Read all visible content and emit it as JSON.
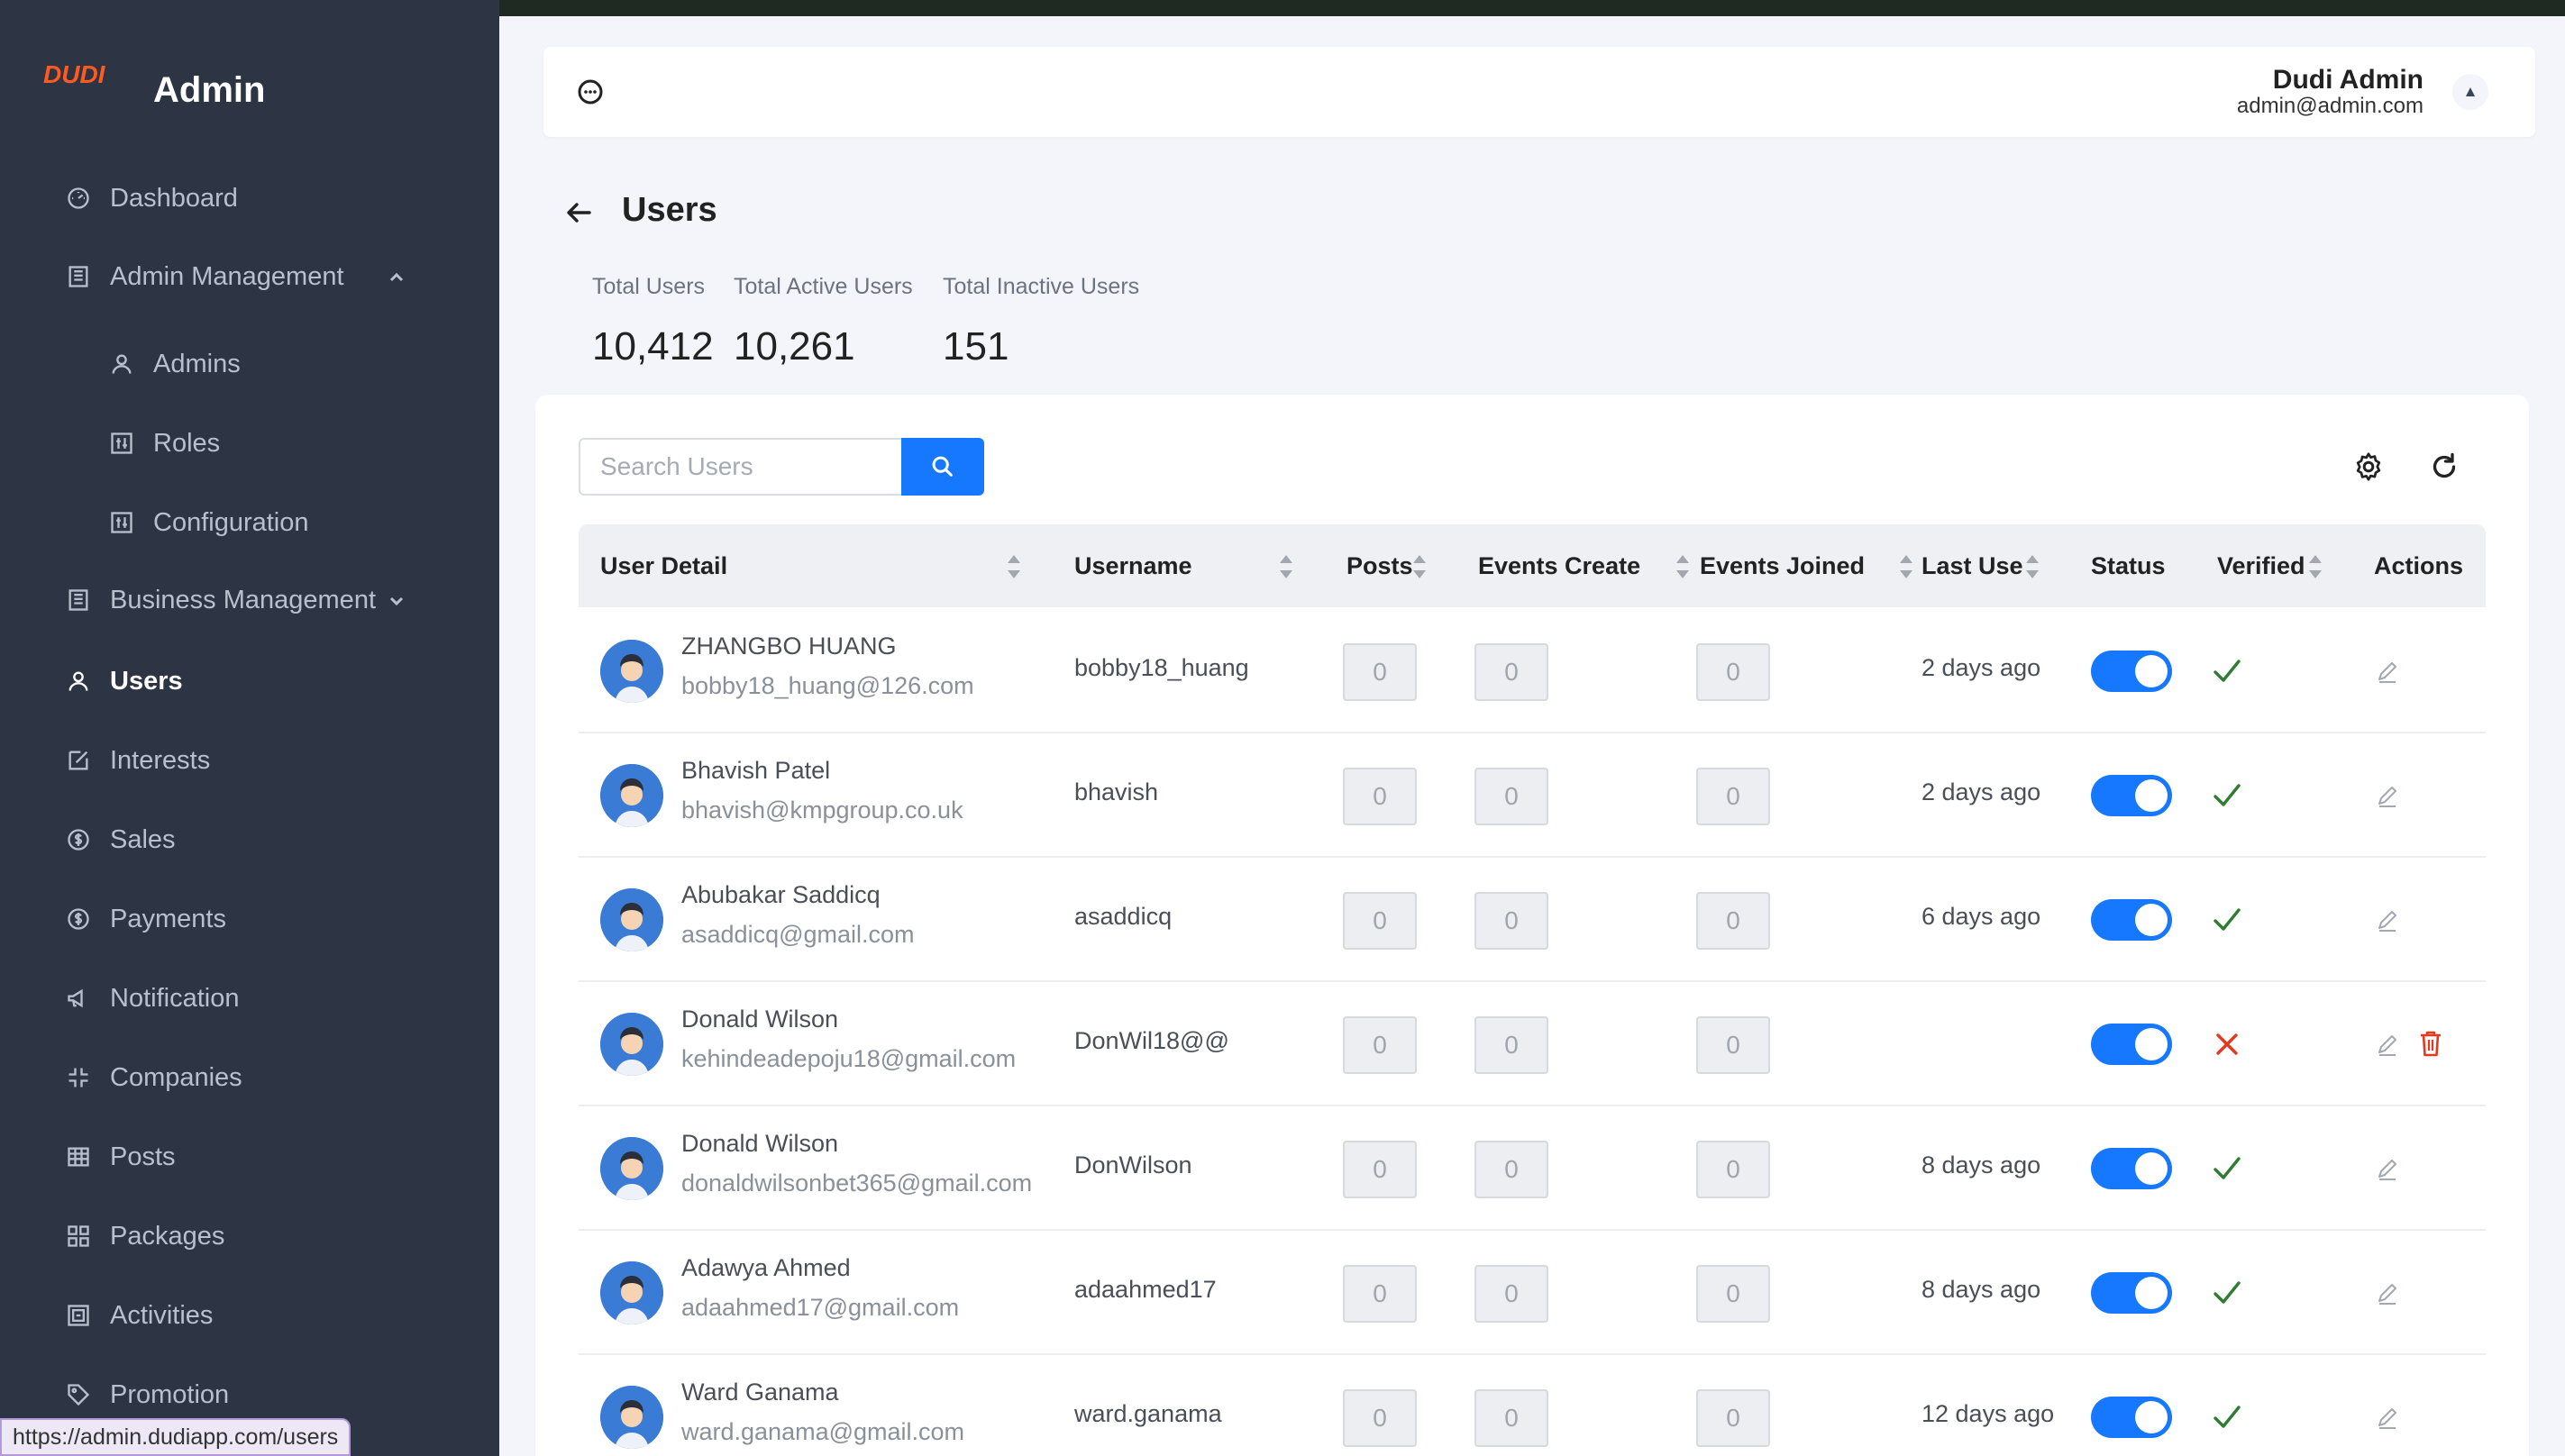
{
  "app": {
    "brand": "Admin",
    "logo_text": "DUDI"
  },
  "sidebar": {
    "items": [
      {
        "label": "Dashboard",
        "icon": "dashboard-icon"
      },
      {
        "label": "Admin Management",
        "icon": "building-icon"
      },
      {
        "label": "Admins",
        "icon": "user-icon"
      },
      {
        "label": "Roles",
        "icon": "sliders-icon"
      },
      {
        "label": "Configuration",
        "icon": "sliders-icon"
      },
      {
        "label": "Business Management",
        "icon": "building-icon"
      },
      {
        "label": "Users",
        "icon": "user-icon"
      },
      {
        "label": "Interests",
        "icon": "edit-square-icon"
      },
      {
        "label": "Sales",
        "icon": "dollar-circle-icon"
      },
      {
        "label": "Payments",
        "icon": "dollar-circle-icon"
      },
      {
        "label": "Notification",
        "icon": "megaphone-icon"
      },
      {
        "label": "Companies",
        "icon": "compress-icon"
      },
      {
        "label": "Posts",
        "icon": "table-icon"
      },
      {
        "label": "Packages",
        "icon": "grid-icon"
      },
      {
        "label": "Activities",
        "icon": "container-icon"
      },
      {
        "label": "Promotion",
        "icon": "tag-icon"
      }
    ],
    "active": "Users"
  },
  "status_url": "https://admin.dudiapp.com/users",
  "header": {
    "user_name": "Dudi Admin",
    "user_email": "admin@admin.com"
  },
  "page": {
    "title": "Users",
    "stats": [
      {
        "label": "Total Users",
        "value": "10,412"
      },
      {
        "label": "Total Active Users",
        "value": "10,261"
      },
      {
        "label": "Total Inactive Users",
        "value": "151"
      }
    ]
  },
  "search": {
    "placeholder": "Search Users",
    "value": ""
  },
  "table": {
    "columns": [
      "User Detail",
      "Username",
      "Posts",
      "Events Create",
      "Events Joined",
      "Last Use",
      "Status",
      "Verified",
      "Actions"
    ],
    "rows": [
      {
        "name": "ZHANGBO HUANG",
        "email": "bobby18_huang@126.com",
        "username": "bobby18_huang",
        "posts": "0",
        "events_create": "0",
        "events_joined": "0",
        "last_use": "2 days ago",
        "status": "active",
        "verified": true,
        "deletable": false
      },
      {
        "name": "Bhavish Patel",
        "email": "bhavish@kmpgroup.co.uk",
        "username": "bhavish",
        "posts": "0",
        "events_create": "0",
        "events_joined": "0",
        "last_use": "2 days ago",
        "status": "active",
        "verified": true,
        "deletable": false
      },
      {
        "name": "Abubakar Saddicq",
        "email": "asaddicq@gmail.com",
        "username": "asaddicq",
        "posts": "0",
        "events_create": "0",
        "events_joined": "0",
        "last_use": "6 days ago",
        "status": "active",
        "verified": true,
        "deletable": false
      },
      {
        "name": "Donald Wilson",
        "email": "kehindeadepoju18@gmail.com",
        "username": "DonWil18@@",
        "posts": "0",
        "events_create": "0",
        "events_joined": "0",
        "last_use": "",
        "status": "active",
        "verified": false,
        "deletable": true
      },
      {
        "name": "Donald Wilson",
        "email": "donaldwilsonbet365@gmail.com",
        "username": "DonWilson",
        "posts": "0",
        "events_create": "0",
        "events_joined": "0",
        "last_use": "8 days ago",
        "status": "active",
        "verified": true,
        "deletable": false
      },
      {
        "name": "Adawya Ahmed",
        "email": "adaahmed17@gmail.com",
        "username": "adaahmed17",
        "posts": "0",
        "events_create": "0",
        "events_joined": "0",
        "last_use": "8 days ago",
        "status": "active",
        "verified": true,
        "deletable": false
      },
      {
        "name": "Ward Ganama",
        "email": "ward.ganama@gmail.com",
        "username": "ward.ganama",
        "posts": "0",
        "events_create": "0",
        "events_joined": "0",
        "last_use": "12 days ago",
        "status": "active",
        "verified": true,
        "deletable": false
      }
    ]
  },
  "colors": {
    "sidebar_bg": "#2d3443",
    "accent": "#1677ff",
    "verified": "#2e7d32",
    "unverified": "#e5391f",
    "delete": "#e5391f"
  }
}
